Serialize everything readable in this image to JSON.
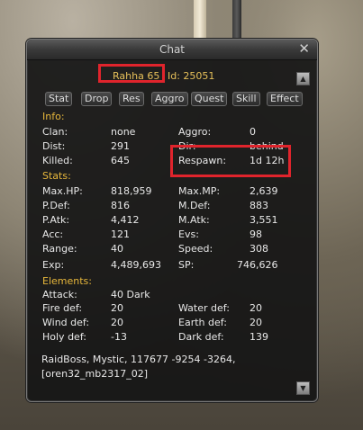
{
  "window": {
    "title": "Chat",
    "close_symbol": "✕"
  },
  "header": {
    "name": "Rahha 65",
    "id_text": "Id: 25051"
  },
  "tabs": [
    "Stat",
    "Drop",
    "Res",
    "Aggro",
    "Quest",
    "Skill",
    "Effect"
  ],
  "info": {
    "heading": "Info:",
    "clan_label": "Clan:",
    "clan_value": "none",
    "dist_label": "Dist:",
    "dist_value": "291",
    "killed_label": "Killed:",
    "killed_value": "645",
    "aggro_label": "Aggro:",
    "aggro_value": "0",
    "dir_label": "Dir:",
    "dir_value": "behind",
    "respawn_label": "Respawn:",
    "respawn_value": "1d 12h"
  },
  "stats": {
    "heading": "Stats:",
    "left": [
      {
        "label": "Max.HP:",
        "value": "818,959"
      },
      {
        "label": "P.Def:",
        "value": "816"
      },
      {
        "label": "P.Atk:",
        "value": "4,412"
      },
      {
        "label": "Acc:",
        "value": "121"
      },
      {
        "label": "Range:",
        "value": "40"
      },
      {
        "label": "Exp:",
        "value": "4,489,693"
      }
    ],
    "right": [
      {
        "label": "Max.MP:",
        "value": "2,639"
      },
      {
        "label": "M.Def:",
        "value": "883"
      },
      {
        "label": "M.Atk:",
        "value": "3,551"
      },
      {
        "label": "Evs:",
        "value": "98"
      },
      {
        "label": "Speed:",
        "value": "308"
      },
      {
        "label": "SP:",
        "value": "746,626"
      }
    ]
  },
  "elements": {
    "heading": "Elements:",
    "attack_label": "Attack:",
    "attack_value": "40 Dark",
    "left": [
      {
        "label": "Fire def:",
        "value": "20"
      },
      {
        "label": "Wind def:",
        "value": "20"
      },
      {
        "label": "Holy def:",
        "value": "-13"
      }
    ],
    "right": [
      {
        "label": "Water def:",
        "value": "20"
      },
      {
        "label": "Earth def:",
        "value": "20"
      },
      {
        "label": "Dark def:",
        "value": "139"
      }
    ]
  },
  "location": {
    "line1": "RaidBoss, Mystic, 117677 -9254 -3264,",
    "line2": "[oren32_mb2317_02]"
  },
  "colors": {
    "accent": "#e7b73b",
    "name": "#e7c15a",
    "highlight": "#e0242c"
  }
}
